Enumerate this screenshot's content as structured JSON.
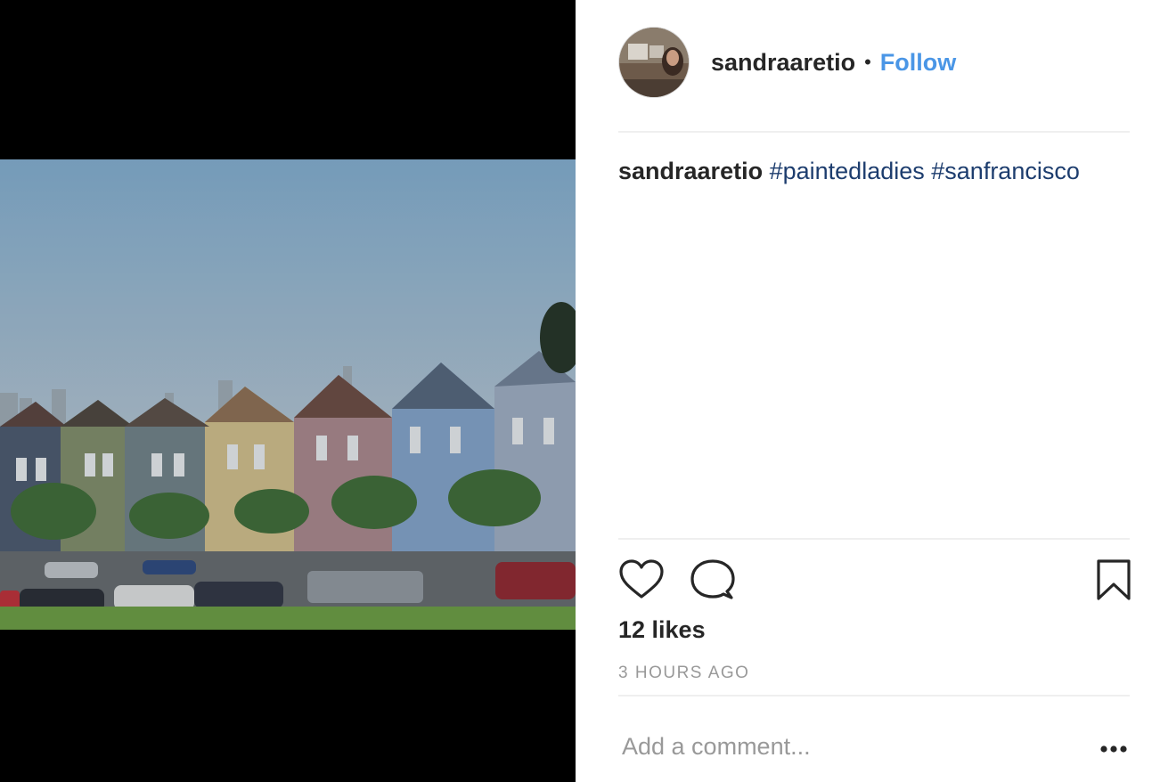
{
  "post": {
    "username": "sandraaretio",
    "separator": "•",
    "follow_label": "Follow",
    "caption": {
      "username": "sandraaretio",
      "hashtags": [
        "#paintedladies",
        "#sanfrancisco"
      ]
    },
    "likes_text": "12 likes",
    "timestamp": "3 HOURS AGO",
    "comment_placeholder": "Add a comment..."
  },
  "icons": {
    "like": "heart-icon",
    "comment": "comment-bubble-icon",
    "save": "bookmark-icon",
    "more": "more-options-icon"
  },
  "colors": {
    "follow_link": "#4a96e6",
    "hashtag": "#1d3d6e",
    "text": "#262626",
    "muted": "#999999",
    "divider": "#efefef",
    "media_background": "#000000"
  }
}
